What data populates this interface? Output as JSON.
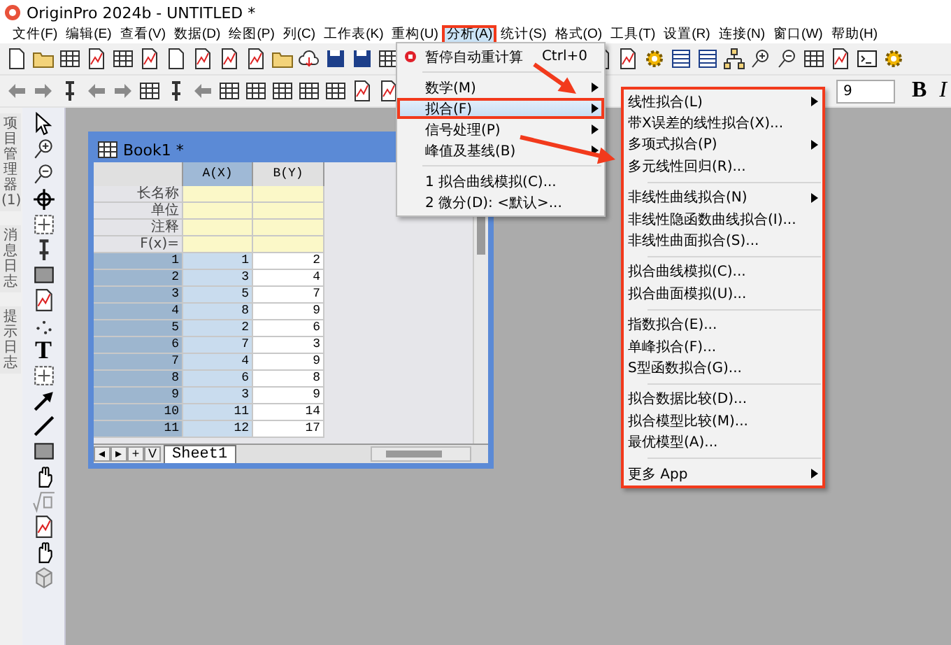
{
  "window": {
    "title": "OriginPro 2024b - UNTITLED *"
  },
  "menubar": [
    {
      "label": "文件(F)",
      "selected": false
    },
    {
      "label": "编辑(E)",
      "selected": false
    },
    {
      "label": "查看(V)",
      "selected": false
    },
    {
      "label": "数据(D)",
      "selected": false
    },
    {
      "label": "绘图(P)",
      "selected": false
    },
    {
      "label": "列(C)",
      "selected": false
    },
    {
      "label": "工作表(K)",
      "selected": false
    },
    {
      "label": "重构(U)",
      "selected": false
    },
    {
      "label": "分析(A)",
      "selected": true
    },
    {
      "label": "统计(S)",
      "selected": false
    },
    {
      "label": "格式(O)",
      "selected": false
    },
    {
      "label": "工具(T)",
      "selected": false
    },
    {
      "label": "设置(R)",
      "selected": false
    },
    {
      "label": "连接(N)",
      "selected": false
    },
    {
      "label": "窗口(W)",
      "selected": false
    },
    {
      "label": "帮助(H)",
      "selected": false
    }
  ],
  "format_toolbar": {
    "font_size": "9",
    "buttons": [
      "B",
      "I"
    ]
  },
  "side_tabs": [
    "项目管理器 (1)",
    "消息日志",
    "提示日志"
  ],
  "left_toolbar": {
    "text_tool": "T"
  },
  "workbook": {
    "title": "Book1 *",
    "columns": [
      {
        "label": "A(X)",
        "selected": true
      },
      {
        "label": "B(Y)",
        "selected": false
      }
    ],
    "meta_rows": [
      "长名称",
      "单位",
      "注释",
      "F(x)="
    ],
    "rows": [
      [
        "1",
        "1",
        "2"
      ],
      [
        "2",
        "3",
        "4"
      ],
      [
        "3",
        "5",
        "7"
      ],
      [
        "4",
        "8",
        "9"
      ],
      [
        "5",
        "2",
        "6"
      ],
      [
        "6",
        "7",
        "3"
      ],
      [
        "7",
        "4",
        "9"
      ],
      [
        "8",
        "6",
        "8"
      ],
      [
        "9",
        "3",
        "9"
      ],
      [
        "10",
        "11",
        "14"
      ],
      [
        "11",
        "12",
        "17"
      ]
    ],
    "sheet_nav": [
      "◂",
      "▸",
      "+",
      "V"
    ],
    "sheet_tab": "Sheet1"
  },
  "menu": {
    "groups": [
      [
        {
          "label": "暂停自动重计算",
          "shortcut": "Ctrl+0",
          "kind": "command",
          "selected": false
        }
      ],
      [
        {
          "label": "数学(M)",
          "kind": "submenu",
          "selected": false
        },
        {
          "label": "拟合(F)",
          "kind": "submenu",
          "selected": true
        },
        {
          "label": "信号处理(P)",
          "kind": "submenu",
          "selected": false
        },
        {
          "label": "峰值及基线(B)",
          "kind": "submenu",
          "selected": false
        }
      ],
      [
        {
          "label": "1 拟合曲线模拟(C)...",
          "kind": "command",
          "selected": false
        },
        {
          "label": "2 微分(D): <默认>...",
          "kind": "command",
          "selected": false
        }
      ]
    ]
  },
  "submenu": {
    "groups": [
      [
        {
          "label": "线性拟合(L)",
          "kind": "submenu"
        },
        {
          "label": "带X误差的线性拟合(X)...",
          "kind": "command"
        },
        {
          "label": "多项式拟合(P)",
          "kind": "submenu"
        },
        {
          "label": "多元线性回归(R)...",
          "kind": "command"
        }
      ],
      [
        {
          "label": "非线性曲线拟合(N)",
          "kind": "submenu"
        },
        {
          "label": "非线性隐函数曲线拟合(I)...",
          "kind": "command"
        },
        {
          "label": "非线性曲面拟合(S)...",
          "kind": "command"
        }
      ],
      [
        {
          "label": "拟合曲线模拟(C)...",
          "kind": "command"
        },
        {
          "label": "拟合曲面模拟(U)...",
          "kind": "command"
        }
      ],
      [
        {
          "label": "指数拟合(E)...",
          "kind": "command"
        },
        {
          "label": "单峰拟合(F)...",
          "kind": "command"
        },
        {
          "label": "S型函数拟合(G)...",
          "kind": "command"
        }
      ],
      [
        {
          "label": "拟合数据比较(D)...",
          "kind": "command"
        },
        {
          "label": "拟合模型比较(M)...",
          "kind": "command"
        },
        {
          "label": "最优模型(A)...",
          "kind": "command"
        }
      ],
      [
        {
          "label": "更多 App",
          "kind": "submenu"
        }
      ]
    ]
  },
  "annotations": [
    {
      "kind": "frame"
    },
    {
      "kind": "frame"
    },
    {
      "kind": "frame"
    },
    {
      "kind": "arrow"
    },
    {
      "kind": "arrow"
    }
  ]
}
